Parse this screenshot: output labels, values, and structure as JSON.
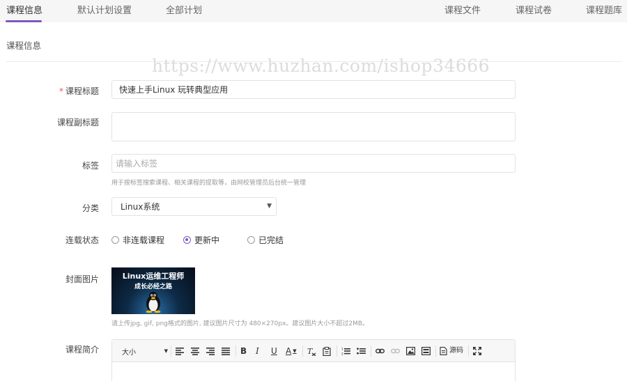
{
  "tabs": [
    {
      "label": "课程信息",
      "active": true
    },
    {
      "label": "默认计划设置"
    },
    {
      "label": "全部计划"
    },
    {
      "label": "课程文件"
    },
    {
      "label": "课程试卷"
    },
    {
      "label": "课程题库"
    }
  ],
  "section_title": "课程信息",
  "watermark": "https://www.huzhan.com/ishop34666",
  "accent_color": "#7e57c2",
  "form": {
    "title": {
      "required_mark": "*",
      "label": "课程标题",
      "value": "快速上手Linux 玩转典型应用"
    },
    "subtitle": {
      "label": "课程副标题",
      "value": ""
    },
    "tags": {
      "label": "标签",
      "placeholder": "请输入标签",
      "help": "用于按标签搜索课程、相关课程的提取等，由网校管理员后台统一管理"
    },
    "category": {
      "label": "分类",
      "value": "Linux系统"
    },
    "serial": {
      "label": "连载状态",
      "options": [
        {
          "label": "非连载课程",
          "checked": false
        },
        {
          "label": "更新中",
          "checked": true
        },
        {
          "label": "已完结",
          "checked": false
        }
      ]
    },
    "cover": {
      "label": "封面图片",
      "image_line1": "Linux运维工程师",
      "image_line2": "成长必经之路",
      "help": "请上传jpg, gif, png格式的图片, 建议图片尺寸为 480×270px。建议图片大小不超过2MB。"
    },
    "intro": {
      "label": "课程简介",
      "toolbar": {
        "font_size": "大小",
        "bold": "B",
        "italic": "I",
        "underline": "U",
        "font_color": "A",
        "source_label": "源码"
      }
    }
  }
}
